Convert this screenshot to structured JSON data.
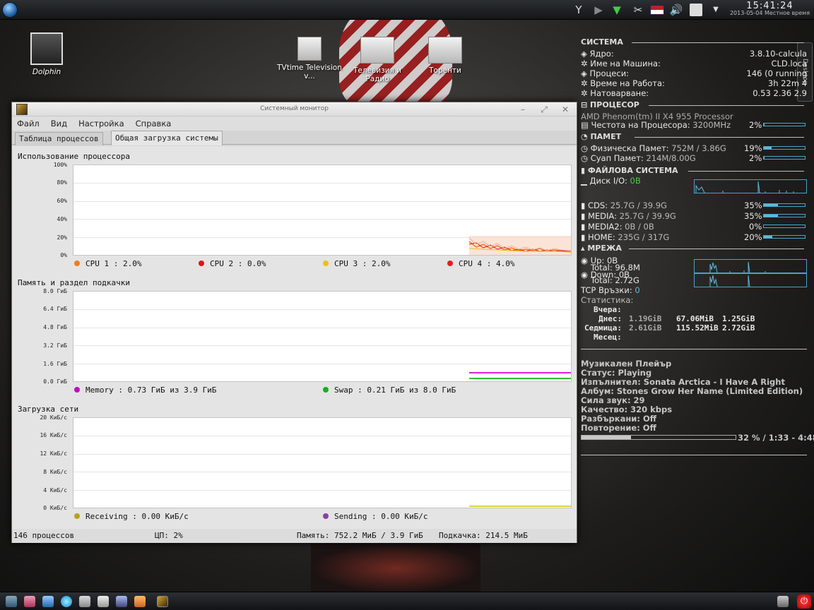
{
  "topbar": {
    "clock_time": "15:41:24",
    "clock_date": "2013-05-04 Местное время"
  },
  "desktop": {
    "icons": [
      {
        "label": "Dolphin"
      },
      {
        "label": "TVtime Television v..."
      },
      {
        "label": "Телевизия и Радио"
      },
      {
        "label": "Торенти"
      }
    ],
    "desktop_tab": "Desktop"
  },
  "window": {
    "title": "Системный монитор",
    "menu": [
      "Файл",
      "Вид",
      "Настройка",
      "Справка"
    ],
    "tabs": [
      "Таблица процессов",
      "Общая загрузка системы"
    ],
    "cpu": {
      "title": "Использование процессора",
      "ticks": [
        "100%",
        "80%",
        "60%",
        "40%",
        "20%",
        "0%"
      ],
      "legend": [
        {
          "label": "CPU 1 : 2.0%",
          "color": "#f07c1c"
        },
        {
          "label": "CPU 2 : 0.0%",
          "color": "#e01414"
        },
        {
          "label": "CPU 3 : 2.0%",
          "color": "#f0c010"
        },
        {
          "label": "CPU 4 : 4.0%",
          "color": "#e02020"
        }
      ]
    },
    "mem": {
      "title": "Память и раздел подкачки",
      "ticks": [
        "8.0 ГиБ",
        "6.4 ГиБ",
        "4.8 ГиБ",
        "3.2 ГиБ",
        "1.6 ГиБ",
        "0.0 ГиБ"
      ],
      "legend": [
        {
          "label": "Memory : 0.73 ГиБ из 3.9 ГиБ",
          "color": "#c010b8"
        },
        {
          "label": "Swap : 0.21 ГиБ из 8.0 ГиБ",
          "color": "#10b020"
        }
      ]
    },
    "net": {
      "title": "Загрузка сети",
      "ticks": [
        "20 КиБ/с",
        "16 КиБ/с",
        "12 КиБ/с",
        "8 КиБ/с",
        "4 КиБ/с",
        "0 КиБ/с"
      ],
      "legend": [
        {
          "label": "Receiving : 0.00 КиБ/с",
          "color": "#b8a020"
        },
        {
          "label": "Sending : 0.00 КиБ/с",
          "color": "#8a40a0"
        }
      ]
    },
    "status": {
      "processes": "146 процессов",
      "cpu": "ЦП: 2%",
      "memory": "Память: 752.2 МиБ / 3.9 ГиБ",
      "swap": "Подкачка: 214.5 МиБ"
    }
  },
  "conky": {
    "h_system": "СИСТЕМА",
    "h_cpu": "ПРОЦЕСОР",
    "h_mem": "ПАМЕТ",
    "h_fs": "ФАЙЛОВА СИСТЕМА",
    "h_net": "МРЕЖА",
    "system": [
      {
        "label": "Ядро:",
        "value": "3.8.10-calcula"
      },
      {
        "label": "Име на Машина:",
        "value": "CLD.loca"
      },
      {
        "label": "Процеси:",
        "value": "146 (0 running"
      },
      {
        "label": "Време на Работа:",
        "value": "3h 22m 4"
      },
      {
        "label": "Натоварване:",
        "value": "0.53 2.36 2.9"
      }
    ],
    "cpu_name": "AMD Phenom(tm) II X4 955 Processor",
    "cpu_freq_label": "Честота на Процесора:",
    "cpu_freq": "3200MHz",
    "cpu_pct": "2%",
    "cpu_usage": 0.02,
    "mem": [
      {
        "label": "Физическа Памет:",
        "value": "752M / 3.86G",
        "pct": "19%",
        "usage": 0.19
      },
      {
        "label": "Суап Памет:",
        "value": "214M/8.00G",
        "pct": "2%",
        "usage": 0.02
      }
    ],
    "disk_label": "Диск I/O:",
    "disk_value": "0B",
    "fs": [
      {
        "label": "CDS:",
        "value": "25.7G / 39.9G",
        "pct": "35%",
        "usage": 0.35
      },
      {
        "label": "MEDIA:",
        "value": "25.7G / 39.9G",
        "pct": "35%",
        "usage": 0.35
      },
      {
        "label": "MEDIA2:",
        "value": "0B / 0B",
        "pct": "0%",
        "usage": 0
      },
      {
        "label": "HOME:",
        "value": "235G / 317G",
        "pct": "20%",
        "usage": 0.2
      }
    ],
    "net_up": "Up: 0B",
    "net_up_total": "Total: 96.8M",
    "net_down": "Down: 0B",
    "net_down_total": "Total: 2.72G",
    "tcp_label": "TCP Връзки:",
    "tcp_value": "0",
    "stats_label": "Статистика:",
    "stats": {
      "yesterday": "Вчера:",
      "today": "Днес:",
      "today_v1": "1.19GiB",
      "today_v2": "67.06MiB",
      "today_v3": "1.25GiB",
      "week": "Седмица:",
      "week_v1": "2.61GiB",
      "week_v2": "115.52MiB",
      "week_v3": "2.72GiB",
      "month": "Месец:"
    },
    "player": {
      "title": "Музикален Плейър",
      "status": "Статус: Playing",
      "artist": "Изпълнител: Sonata Arctica - I Have A Right",
      "album": "Албум: Stones Grow Her Name (Limited Edition)",
      "volume": "Сила звук: 29",
      "quality": "Качество: 320 kbps",
      "shuffle": "Разбъркани: Off",
      "repeat": "Повторение: Off",
      "progress_text": "32 % / 1:33 - 4:48",
      "progress": 0.32
    }
  }
}
